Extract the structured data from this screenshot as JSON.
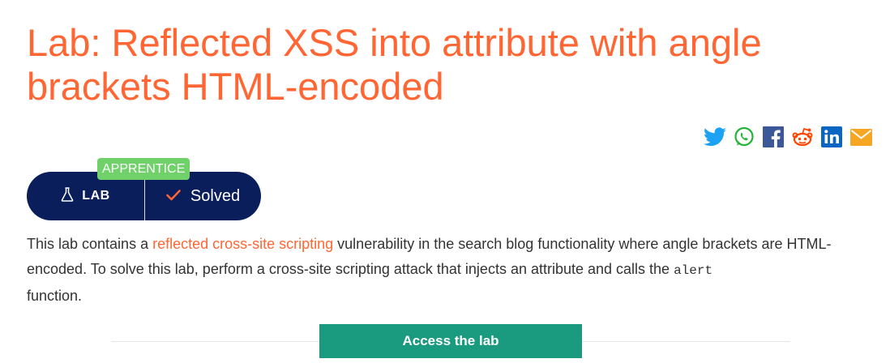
{
  "title": "Lab: Reflected XSS into attribute with angle brackets HTML-encoded",
  "share": {
    "icons": [
      "twitter-icon",
      "whatsapp-icon",
      "facebook-icon",
      "reddit-icon",
      "linkedin-icon",
      "email-icon"
    ]
  },
  "lab_badge": {
    "level": "APPRENTICE",
    "lab_label": "LAB",
    "status": "Solved"
  },
  "description": {
    "part1": "This lab contains a ",
    "link": "reflected cross-site scripting",
    "part2": " vulnerability in the search blog functionality where angle brackets are HTML-encoded. To solve this lab, perform a cross-site scripting attack that injects an attribute and calls the ",
    "code": "alert",
    "part3": " function."
  },
  "access_button": "Access the lab",
  "colors": {
    "title": "#ff6633",
    "pill": "#0a1e5c",
    "badge": "#70d16b",
    "button": "#1a9b80",
    "link": "#ff6633"
  }
}
